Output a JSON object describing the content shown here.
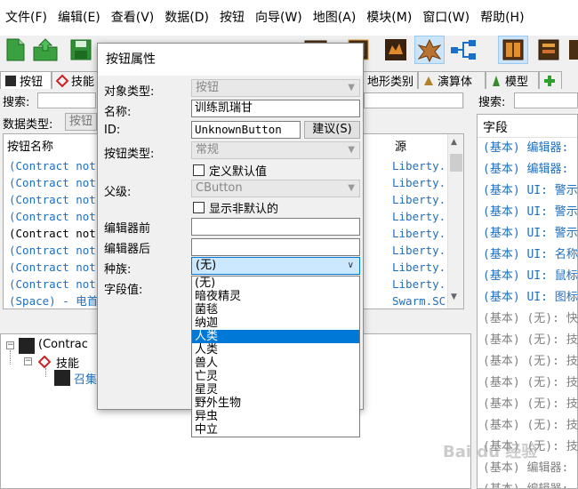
{
  "menu": [
    "文件(F)",
    "编辑(E)",
    "查看(V)",
    "数据(D)",
    "按钮",
    "向导(W)",
    "地图(A)",
    "模块(M)",
    "窗口(W)",
    "帮助(H)"
  ],
  "toolbar": {
    "icons": [
      "new-file-icon",
      "open-folder-icon",
      "save-icon",
      "object-editor-icon",
      "book-icon",
      "bronze-book-icon",
      "beast-icon",
      "spider-unit-icon",
      "network-icon",
      "orange-book-icon",
      "panel-icon"
    ]
  },
  "tabs": [
    {
      "label": "按钮",
      "icon": "button-icon"
    },
    {
      "label": "技能",
      "icon": "ability-icon"
    },
    {
      "label": "地形类别",
      "icon": "terrain-icon"
    },
    {
      "label": "演算体",
      "icon": "actor-icon"
    },
    {
      "label": "模型",
      "icon": "model-icon"
    }
  ],
  "search_label": "搜索:",
  "data_type_label": "数据类型:",
  "data_type_value": "按钮",
  "left_list": {
    "header_name": "按钮名称",
    "header_source": "源",
    "rows": [
      {
        "name": "(Contract not",
        "source": "Liberty.",
        "color": "#1f6fbf"
      },
      {
        "name": "(Contract not",
        "source": "Liberty.",
        "color": "#1f6fbf"
      },
      {
        "name": "(Contract not",
        "source": "Liberty.",
        "color": "#1f6fbf"
      },
      {
        "name": "(Contract not",
        "source": "Liberty.",
        "color": "#1f6fbf"
      },
      {
        "name": "(Contract not",
        "source": "Liberty.",
        "color": "#000000"
      },
      {
        "name": "(Contract not",
        "source": "Liberty.",
        "color": "#1f6fbf"
      },
      {
        "name": "(Contract not",
        "source": "Liberty.",
        "color": "#1f6fbf"
      },
      {
        "name": "(Contract not",
        "source": "Liberty.",
        "color": "#1f6fbf"
      },
      {
        "name": "(Space) - 电首",
        "source": "Swarm.SC",
        "color": "#1f6fbf"
      }
    ]
  },
  "tree": {
    "root": "(Contrac",
    "child": "技能",
    "leaf": "召集"
  },
  "right_panel": {
    "search_label": "搜索:",
    "header": "字段",
    "rows": [
      {
        "text": "(基本) 编辑器:",
        "color": "#1f6fbf"
      },
      {
        "text": "(基本) 编辑器:",
        "color": "#1f6fbf"
      },
      {
        "text": "(基本) UI: 警示",
        "color": "#1f6fbf"
      },
      {
        "text": "(基本) UI: 警示",
        "color": "#1f6fbf"
      },
      {
        "text": "(基本) UI: 警示",
        "color": "#1f6fbf"
      },
      {
        "text": "(基本) UI: 名称",
        "color": "#1f6fbf"
      },
      {
        "text": "(基本) UI: 鼠标",
        "color": "#1f6fbf"
      },
      {
        "text": "(基本) UI: 图标",
        "color": "#1f6fbf"
      },
      {
        "text": "(基本) (无): 快",
        "color": "#808080"
      },
      {
        "text": "(基本) (无): 技",
        "color": "#808080"
      },
      {
        "text": "(基本) (无): 技",
        "color": "#808080"
      },
      {
        "text": "(基本) (无): 技",
        "color": "#808080"
      },
      {
        "text": "(基本) (无): 技",
        "color": "#808080"
      },
      {
        "text": "(基本) (无): 技",
        "color": "#808080"
      },
      {
        "text": "(基本) (无): 技",
        "color": "#808080"
      },
      {
        "text": "(基本) 编辑器:",
        "color": "#808080"
      },
      {
        "text": "(基本) 编辑器:",
        "color": "#808080"
      }
    ]
  },
  "dialog": {
    "title": "按钮属性",
    "object_type_label": "对象类型:",
    "object_type_value": "按钮",
    "name_label": "名称:",
    "name_value": "训练凯瑞甘",
    "id_label": "ID:",
    "id_value": "UnknownButton",
    "suggest_button": "建议(S)",
    "button_type_label": "按钮类型:",
    "button_type_value": "常规",
    "define_default_label": "定义默认值",
    "parent_label": "父级:",
    "parent_value": "CButton",
    "show_non_default_label": "显示非默认的",
    "editor_prefix_label": "编辑器前",
    "editor_suffix_label": "编辑器后",
    "race_label": "种族:",
    "race_value": "(无)",
    "field_value_label": "字段值:",
    "race_options": [
      "(无)",
      "暗夜精灵",
      "菌毯",
      "纳迦",
      "人类",
      "人类",
      "兽人",
      "亡灵",
      "星灵",
      "野外生物",
      "异虫",
      "中立"
    ],
    "highlighted_index": 4
  },
  "watermark": "Bai du 经验"
}
